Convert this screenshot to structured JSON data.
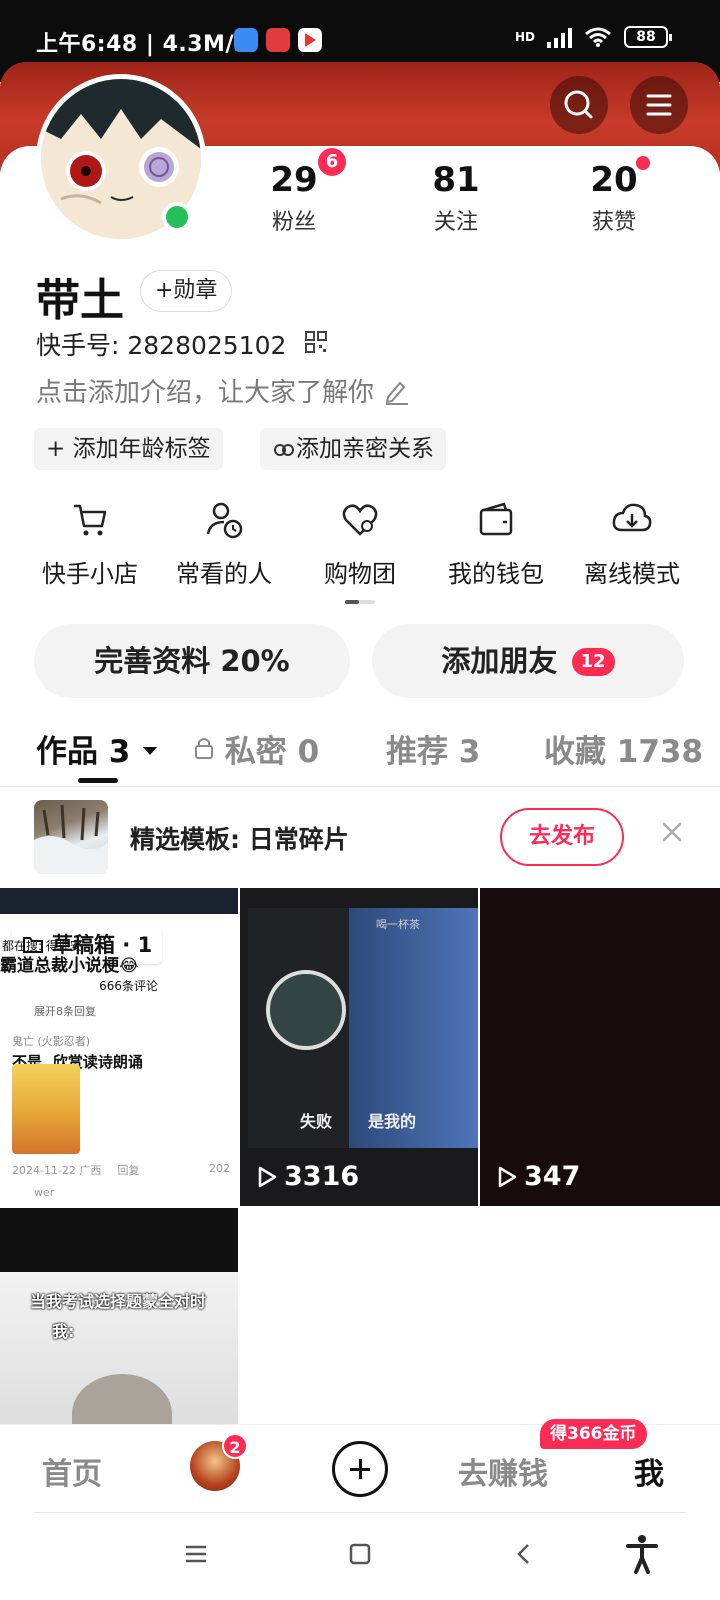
{
  "status_bar": {
    "time_speed": "上午6:48 | 4.3M/s",
    "battery": "88",
    "network": "HD"
  },
  "header": {
    "search_icon": "search-icon",
    "menu_icon": "menu-icon"
  },
  "profile": {
    "name": "带土",
    "medal_label": "+勋章",
    "kuaishou_id": "快手号: 2828025102",
    "intro": "点击添加介绍，让大家了解你",
    "tags": [
      "+ 添加年龄标签",
      "添加亲密关系"
    ],
    "stats": [
      {
        "value": "29",
        "label": "粉丝",
        "badge": "6"
      },
      {
        "value": "81",
        "label": "关注"
      },
      {
        "value": "20",
        "label": "获赞"
      }
    ]
  },
  "quick_actions": [
    {
      "label": "快手小店",
      "icon": "cart-icon"
    },
    {
      "label": "常看的人",
      "icon": "person-clock-icon"
    },
    {
      "label": "购物团",
      "icon": "heart-group-icon"
    },
    {
      "label": "我的钱包",
      "icon": "wallet-icon"
    },
    {
      "label": "离线模式",
      "icon": "cloud-download-icon"
    }
  ],
  "pills": {
    "complete_profile": "完善资料 20%",
    "add_friends": "添加朋友",
    "add_friends_badge": "12"
  },
  "tabs": [
    {
      "label": "作品 3",
      "active": true
    },
    {
      "label": "私密 0"
    },
    {
      "label": "推荐 3"
    },
    {
      "label": "收藏 1738"
    }
  ],
  "template_bar": {
    "text": "精选模板: 日常碎片",
    "button": "去发布"
  },
  "grid": {
    "draft_label": "草稿箱 · 1",
    "play_counts": [
      "3316",
      "347"
    ],
    "comment_preview": {
      "line1": "都在搜: 得押安",
      "line2": "霸道总裁小说梗😂",
      "line3": "666条评论",
      "expand": "展开8条回复",
      "user": "鬼亡 (火影忍者)",
      "text": "不是, 欣赏读诗朗诵",
      "date": "2024-11-22 广西",
      "reply": "回复",
      "likes": "202",
      "user2": "wer"
    },
    "video2_text": [
      "喝一杯茶",
      "失败",
      "是我的"
    ],
    "meme_text": [
      "当我考试选择题蒙全对时",
      "我:"
    ]
  },
  "bottom_nav": {
    "home": "首页",
    "avatar_badge": "2",
    "earn": "去赚钱",
    "coin_badge": "得366金币",
    "me": "我"
  },
  "colors": {
    "accent": "#fe2c55",
    "online": "#26c05a",
    "banner": "#c93b2a"
  }
}
